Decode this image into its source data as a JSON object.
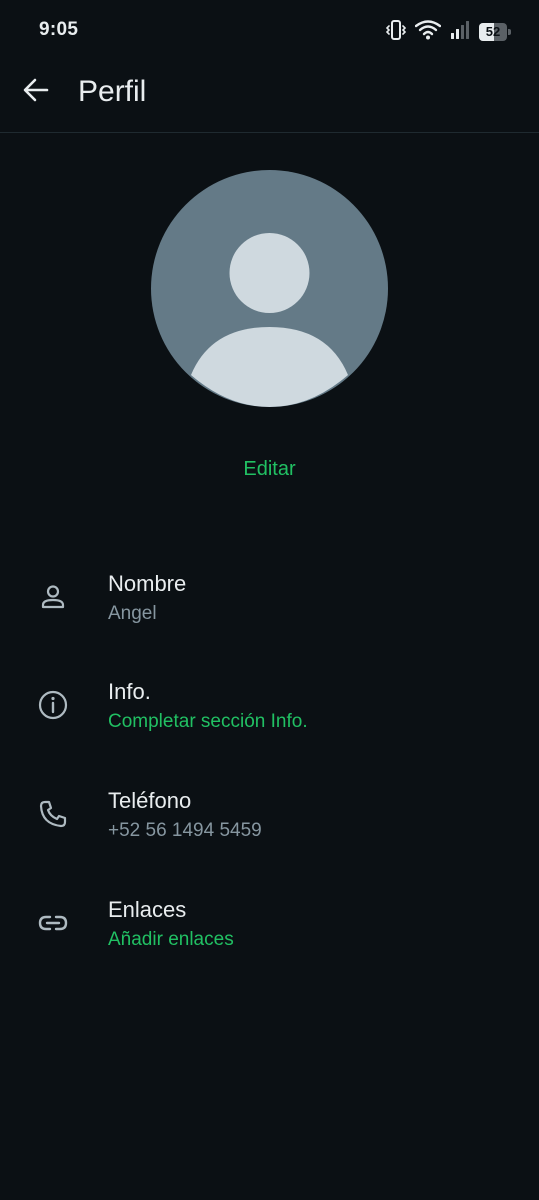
{
  "status_bar": {
    "time": "9:05",
    "battery": "52",
    "battery_level": 0.52,
    "icons": [
      "vibrate-icon",
      "wifi-icon",
      "signal-icon",
      "battery-icon"
    ]
  },
  "app_bar": {
    "title": "Perfil",
    "back_icon": "arrow-left-icon"
  },
  "profile": {
    "edit_label": "Editar"
  },
  "fields": [
    {
      "label": "Nombre",
      "value": "Angel",
      "icon": "person-icon"
    },
    {
      "label": "Info.",
      "value": "Completar sección Info.",
      "icon": "info-icon"
    },
    {
      "label": "Teléfono",
      "value": "+52 56 1494 5459",
      "icon": "phone-icon"
    },
    {
      "label": "Enlaces",
      "value": "Añadir enlaces",
      "icon": "link-icon"
    }
  ],
  "colors": {
    "background": "#0b1014",
    "text_primary": "#e9edef",
    "text_secondary": "#8696a0",
    "accent": "#21c063",
    "avatar_bg": "#647a87",
    "avatar_fg": "#cfd9df"
  }
}
